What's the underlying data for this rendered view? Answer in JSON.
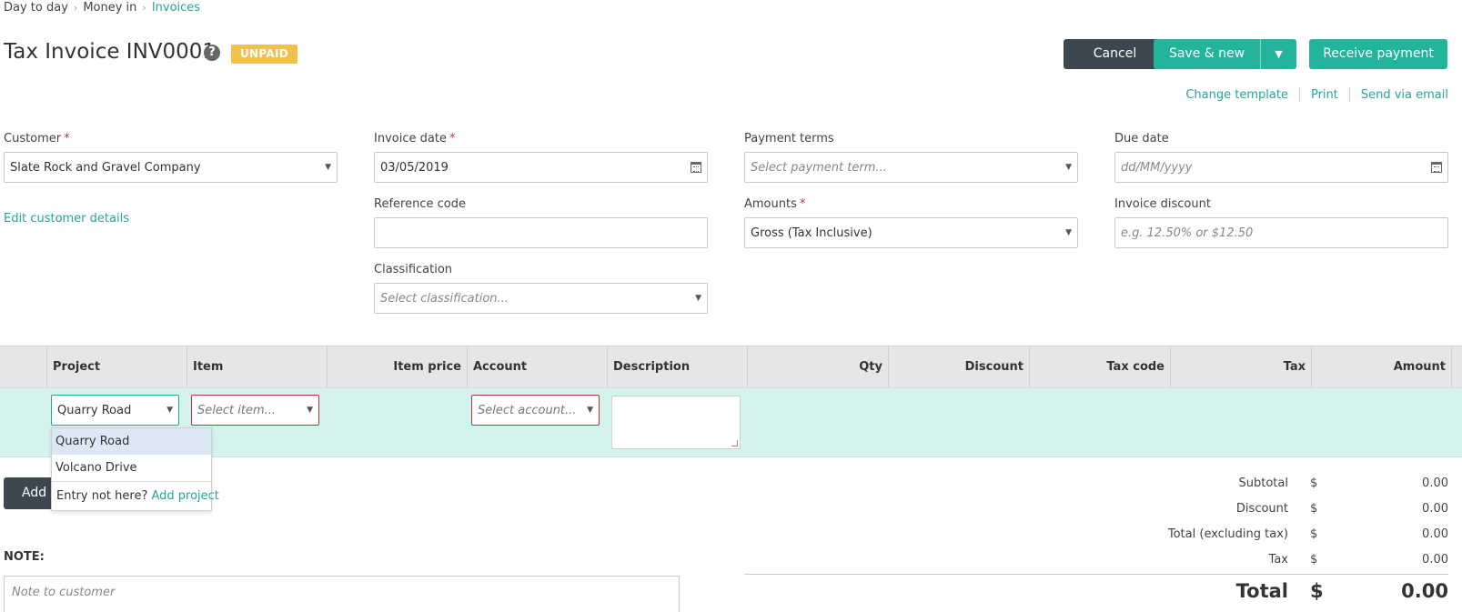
{
  "breadcrumb": {
    "items": [
      "Day to day",
      "Money in",
      "Invoices"
    ]
  },
  "header": {
    "title": "Tax Invoice INV0001",
    "status": "UNPAID",
    "cancel_label": "Cancel",
    "save_new_label": "Save & new",
    "receive_label": "Receive payment",
    "links": [
      "Change template",
      "Print",
      "Send via email"
    ]
  },
  "form": {
    "customer": {
      "label": "Customer",
      "value": "Slate Rock and Gravel Company"
    },
    "edit_customer": "Edit customer details",
    "invoice_date": {
      "label": "Invoice date",
      "value": "03/05/2019"
    },
    "reference": {
      "label": "Reference code",
      "value": ""
    },
    "classification": {
      "label": "Classification",
      "placeholder": "Select classification..."
    },
    "payment_terms": {
      "label": "Payment terms",
      "placeholder": "Select payment term..."
    },
    "amounts": {
      "label": "Amounts",
      "value": "Gross (Tax Inclusive)"
    },
    "due_date": {
      "label": "Due date",
      "placeholder": "dd/MM/yyyy"
    },
    "invoice_discount": {
      "label": "Invoice discount",
      "placeholder": "e.g. 12.50% or $12.50"
    }
  },
  "table": {
    "columns": [
      "Project",
      "Item",
      "Item price",
      "Account",
      "Description",
      "Qty",
      "Discount",
      "Tax code",
      "Tax",
      "Amount"
    ],
    "row": {
      "project": "Quarry Road",
      "item_placeholder": "Select item...",
      "account_placeholder": "Select account..."
    },
    "dropdown": {
      "options": [
        "Quarry Road",
        "Volcano Drive"
      ],
      "footer_text": "Entry not here?",
      "footer_link": "Add project"
    }
  },
  "add_button_label": "Add",
  "note": {
    "label": "NOTE:",
    "placeholder": "Note to customer"
  },
  "totals": {
    "currency": "$",
    "rows": [
      {
        "label": "Subtotal",
        "value": "0.00"
      },
      {
        "label": "Discount",
        "value": "0.00"
      },
      {
        "label": "Total (excluding tax)",
        "value": "0.00"
      },
      {
        "label": "Tax",
        "value": "0.00"
      }
    ],
    "total_label": "Total",
    "total_value": "0.00"
  },
  "colors": {
    "accent": "#23b49c",
    "dark": "#3d4752",
    "badge": "#f0c14b",
    "row_bg": "#d5f2ec",
    "error": "#b5353a"
  }
}
